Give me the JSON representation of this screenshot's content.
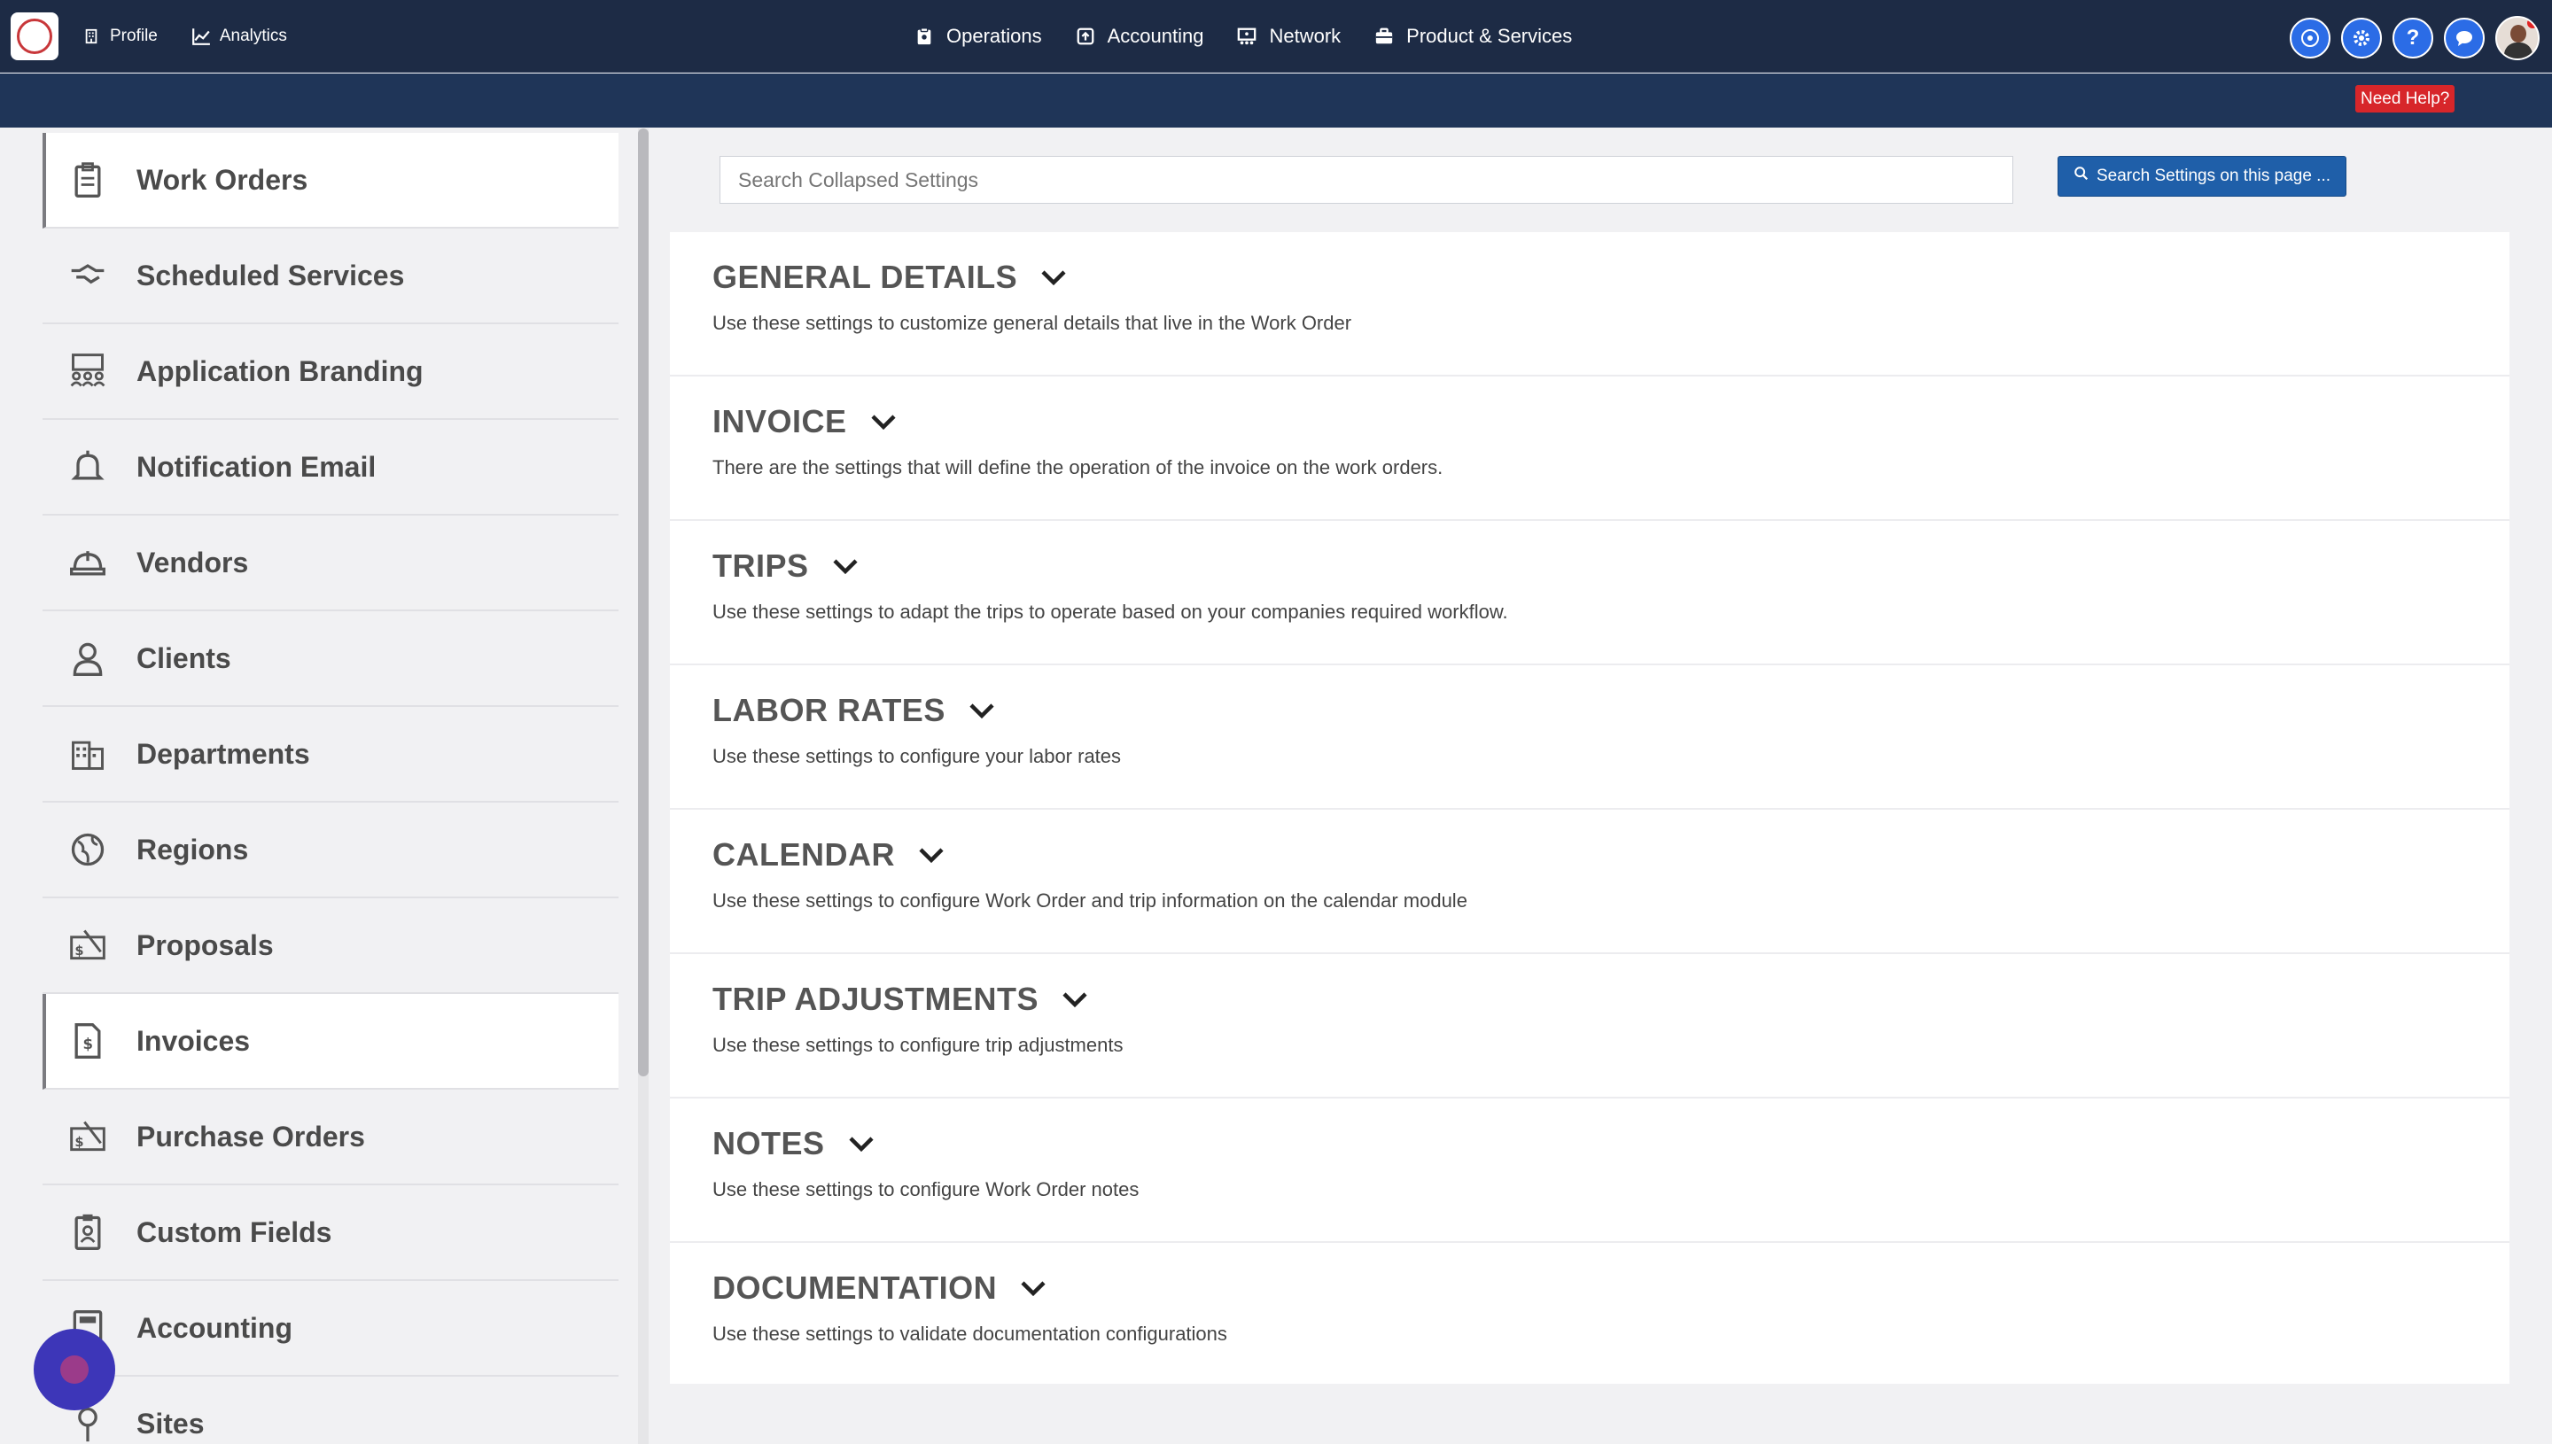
{
  "topnav": {
    "left": [
      {
        "label": "Profile",
        "icon": "building-icon"
      },
      {
        "label": "Analytics",
        "icon": "chart-line-icon"
      }
    ],
    "center": [
      {
        "label": "Operations",
        "icon": "clipboard-icon"
      },
      {
        "label": "Accounting",
        "icon": "accounting-icon"
      },
      {
        "label": "Network",
        "icon": "network-icon"
      },
      {
        "label": "Product & Services",
        "icon": "briefcase-icon"
      }
    ],
    "right_icons": [
      "compass-icon",
      "gear-icon",
      "help-icon",
      "chat-icon",
      "avatar"
    ],
    "need_help": "Need Help?"
  },
  "sidebar": {
    "items": [
      {
        "label": "Work Orders",
        "icon": "clipboard-list-icon",
        "active": true
      },
      {
        "label": "Scheduled Services",
        "icon": "handshake-icon",
        "active": false
      },
      {
        "label": "Application Branding",
        "icon": "users-board-icon",
        "active": false
      },
      {
        "label": "Notification Email",
        "icon": "bell-icon",
        "active": false
      },
      {
        "label": "Vendors",
        "icon": "hard-hat-icon",
        "active": false
      },
      {
        "label": "Clients",
        "icon": "user-icon",
        "active": false
      },
      {
        "label": "Departments",
        "icon": "buildings-icon",
        "active": false
      },
      {
        "label": "Regions",
        "icon": "globe-icon",
        "active": false
      },
      {
        "label": "Proposals",
        "icon": "proposal-icon",
        "active": false
      },
      {
        "label": "Invoices",
        "icon": "invoice-icon",
        "active": true
      },
      {
        "label": "Purchase Orders",
        "icon": "purchase-order-icon",
        "active": false
      },
      {
        "label": "Custom Fields",
        "icon": "id-badge-icon",
        "active": false
      },
      {
        "label": "Accounting",
        "icon": "calculator-icon",
        "active": false
      },
      {
        "label": "Sites",
        "icon": "map-pin-icon",
        "active": false
      }
    ]
  },
  "search": {
    "placeholder": "Search Collapsed Settings",
    "button_label": "Search Settings on this page ..."
  },
  "sections": [
    {
      "title": "GENERAL DETAILS",
      "description": "Use these settings to customize general details that live in the Work Order"
    },
    {
      "title": "INVOICE",
      "description": "There are the settings that will define the operation of the invoice on the work orders."
    },
    {
      "title": "TRIPS",
      "description": "Use these settings to adapt the trips to operate based on your companies required workflow."
    },
    {
      "title": "LABOR RATES",
      "description": "Use these settings to configure your labor rates"
    },
    {
      "title": "CALENDAR",
      "description": "Use these settings to configure Work Order and trip information on the calendar module"
    },
    {
      "title": "TRIP ADJUSTMENTS",
      "description": "Use these settings to configure trip adjustments"
    },
    {
      "title": "NOTES",
      "description": "Use these settings to configure Work Order notes"
    },
    {
      "title": "DOCUMENTATION",
      "description": "Use these settings to validate documentation configurations"
    }
  ],
  "colors": {
    "topbar": "#1d2b45",
    "subbar": "#1f3558",
    "accent_blue": "#2b6ce6",
    "need_help_red": "#d7262a"
  }
}
